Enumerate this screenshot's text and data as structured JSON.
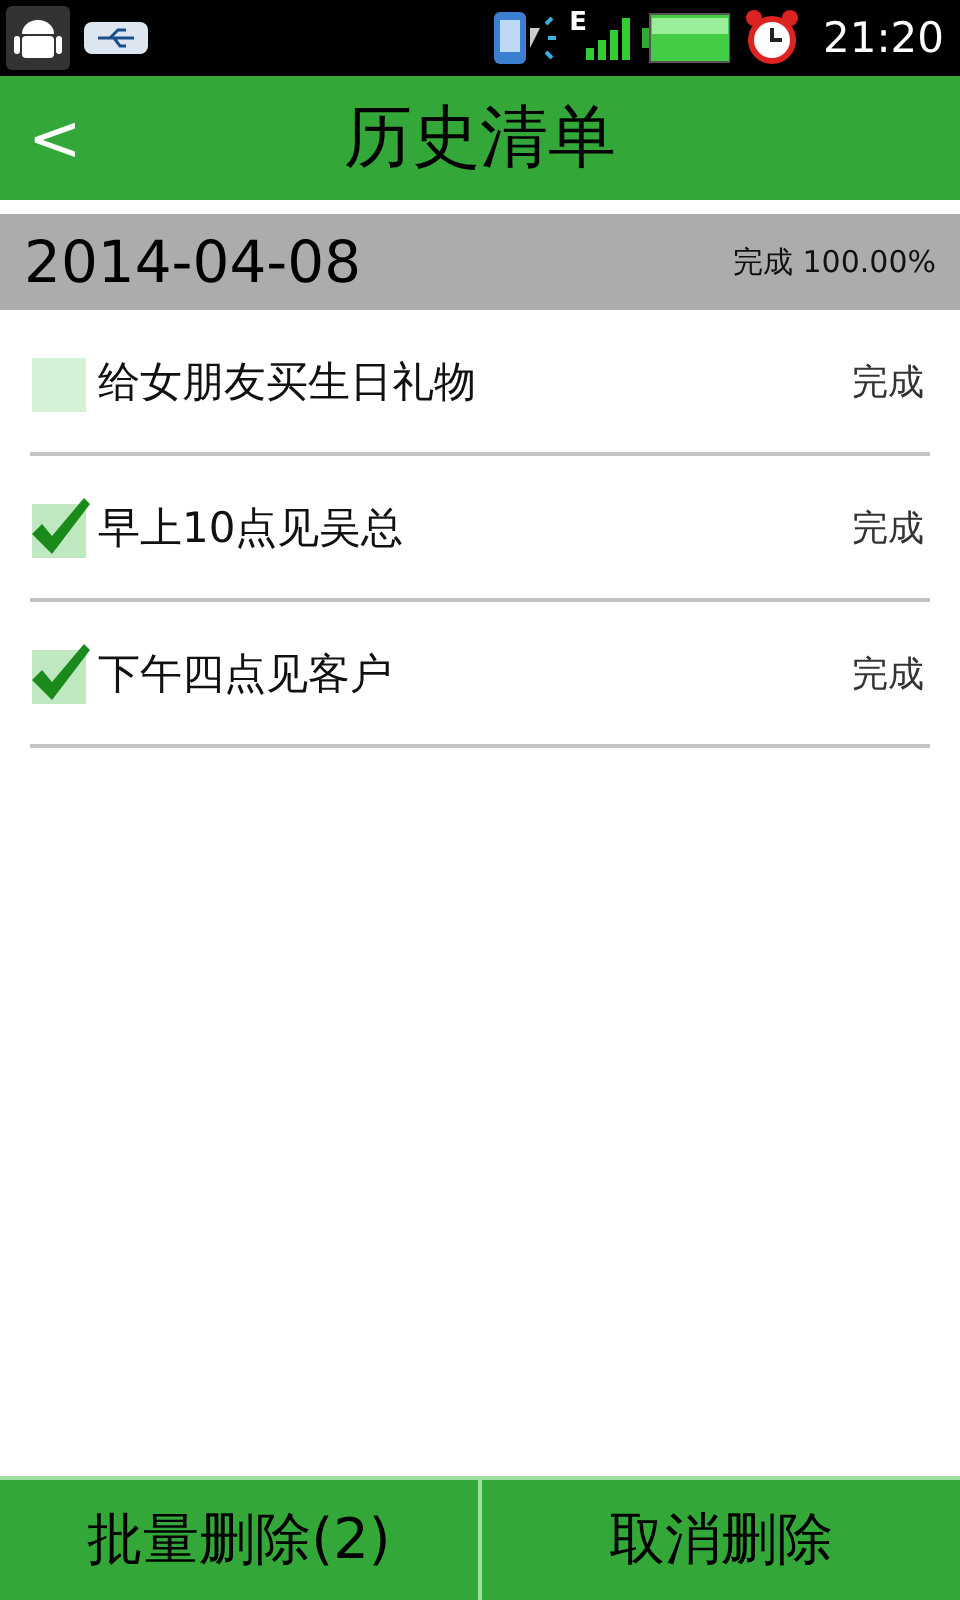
{
  "status_bar": {
    "network": "E",
    "time": "21:20"
  },
  "header": {
    "back": "<",
    "title": "历史清单"
  },
  "day": {
    "date": "2014-04-08",
    "summary": "完成 100.00%"
  },
  "tasks": [
    {
      "text": "给女朋友买生日礼物",
      "status": "完成",
      "checked": false
    },
    {
      "text": "早上10点见吴总",
      "status": "完成",
      "checked": true
    },
    {
      "text": "下午四点见客户",
      "status": "完成",
      "checked": true
    }
  ],
  "buttons": [
    "批量删除(2)",
    "取消删除"
  ]
}
